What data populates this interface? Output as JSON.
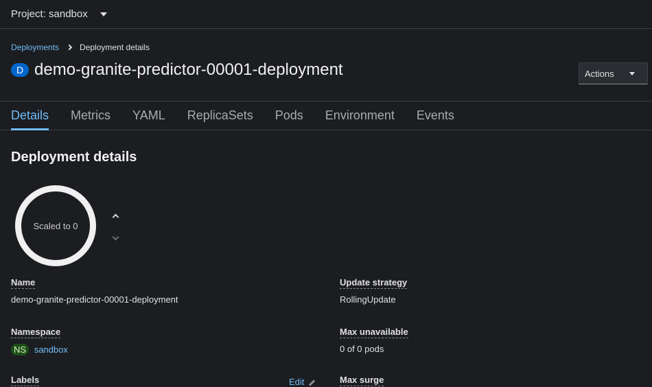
{
  "project_bar": {
    "label": "Project: sandbox"
  },
  "breadcrumb": {
    "parent": "Deployments",
    "current": "Deployment details"
  },
  "resource": {
    "badge": "D",
    "title": "demo-granite-predictor-00001-deployment"
  },
  "actions": {
    "label": "Actions"
  },
  "tabs": [
    {
      "label": "Details",
      "active": true
    },
    {
      "label": "Metrics"
    },
    {
      "label": "YAML"
    },
    {
      "label": "ReplicaSets"
    },
    {
      "label": "Pods"
    },
    {
      "label": "Environment"
    },
    {
      "label": "Events"
    }
  ],
  "section": {
    "title": "Deployment details"
  },
  "pod_ring": {
    "text": "Scaled to 0"
  },
  "details_left": {
    "name_label": "Name",
    "name_value": "demo-granite-predictor-00001-deployment",
    "namespace_label": "Namespace",
    "namespace_badge": "NS",
    "namespace_value": "sandbox",
    "labels_label": "Labels",
    "edit_label": "Edit"
  },
  "details_right": {
    "strategy_label": "Update strategy",
    "strategy_value": "RollingUpdate",
    "max_unavailable_label": "Max unavailable",
    "max_unavailable_value": "0 of 0 pods",
    "max_surge_label": "Max surge"
  }
}
